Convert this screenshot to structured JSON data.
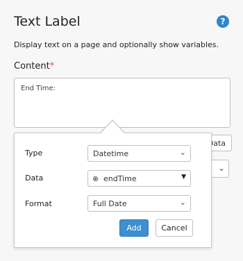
{
  "panel": {
    "title": "Text Label",
    "help_icon_glyph": "?",
    "description": "Display text on a page and optionally show variables.",
    "content_label": "Content",
    "required_marker": "*",
    "content_value": "End Time:"
  },
  "background": {
    "data_button_label": "Data",
    "select_chevron": "⌄"
  },
  "popover": {
    "type_label": "Type",
    "type_value": "Datetime",
    "data_label": "Data",
    "data_value": "endTime",
    "format_label": "Format",
    "format_value": "Full Date",
    "chevron_glyph": "⌄",
    "dropdown_glyph": "▼",
    "add_label": "Add",
    "cancel_label": "Cancel"
  },
  "colors": {
    "accent": "#3c8fd1",
    "help": "#2f86c8",
    "required": "#d9534f"
  }
}
